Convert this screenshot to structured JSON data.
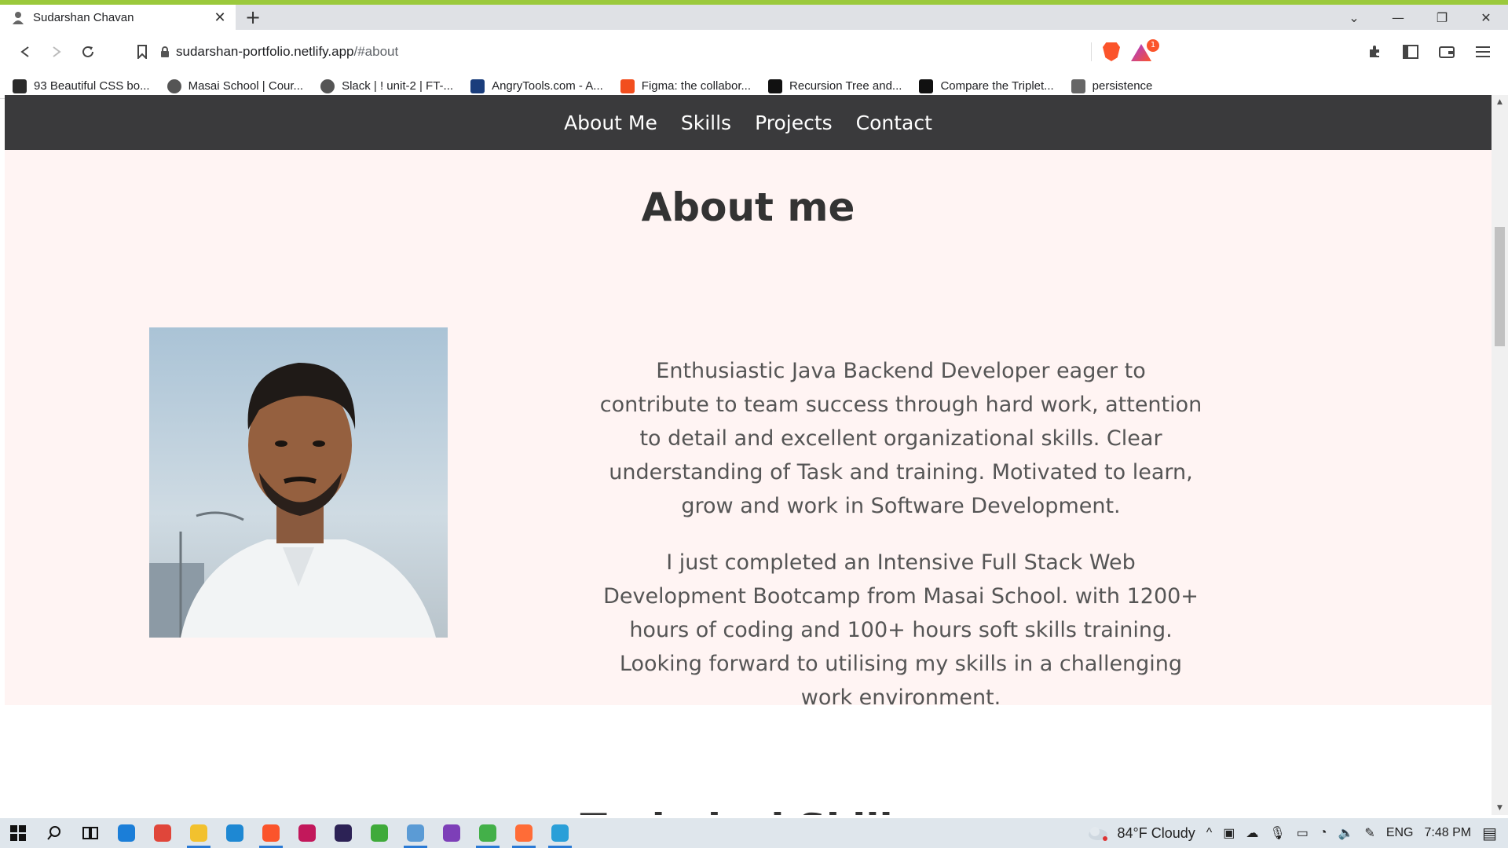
{
  "browser": {
    "tab_title": "Sudarshan Chavan",
    "url_host": "sudarshan-portfolio.netlify.app",
    "url_path": "/#about",
    "rewards_badge": "1",
    "bookmarks": [
      {
        "label": "93 Beautiful CSS bo...",
        "icon": "css-bookmark-icon",
        "color": "#2b2b2b"
      },
      {
        "label": "Masai School | Cour...",
        "icon": "globe-icon",
        "color": "#555555"
      },
      {
        "label": "Slack | ! unit-2 | FT-...",
        "icon": "globe-icon",
        "color": "#555555"
      },
      {
        "label": "AngryTools.com - A...",
        "icon": "angrytools-icon",
        "color": "#1a3d7c"
      },
      {
        "label": "Figma: the collabor...",
        "icon": "figma-icon",
        "color": "#f24e1e"
      },
      {
        "label": "Recursion Tree and...",
        "icon": "recursion-icon",
        "color": "#111111"
      },
      {
        "label": "Compare the Triplet...",
        "icon": "hackerrank-icon",
        "color": "#111111"
      },
      {
        "label": "persistence",
        "icon": "persistence-icon",
        "color": "#666666"
      }
    ]
  },
  "page": {
    "nav": [
      "About Me",
      "Skills",
      "Projects",
      "Contact"
    ],
    "about_title": "About me",
    "paragraphs": [
      "Enthusiastic Java Backend Developer eager to contribute to team success through hard work, attention to detail and excellent organizational skills. Clear understanding of Task and training. Motivated to learn, grow and work in Software Development.",
      "I just completed an Intensive Full Stack Web Development Bootcamp from Masai School. with 1200+ hours of coding and 100+ hours soft skills training. Looking forward to utilising my skills in a challenging work environment."
    ],
    "next_section_title": "Technical Skills"
  },
  "taskbar": {
    "weather": "84°F  Cloudy",
    "language": "ENG",
    "time": "7:48 PM",
    "apps": [
      {
        "name": "edge-icon",
        "color": "#1b7ed8",
        "active": false
      },
      {
        "name": "chrome-icon",
        "color": "#e0463a",
        "active": false
      },
      {
        "name": "file-explorer-icon",
        "color": "#f2c12e",
        "active": true
      },
      {
        "name": "vscode-icon",
        "color": "#1e88d3",
        "active": false
      },
      {
        "name": "brave-icon",
        "color": "#fb542b",
        "active": true
      },
      {
        "name": "intellij-icon",
        "color": "#c2185b",
        "active": false
      },
      {
        "name": "eclipse-icon",
        "color": "#2c2255",
        "active": false
      },
      {
        "name": "app-green-icon",
        "color": "#3faa3a",
        "active": false
      },
      {
        "name": "app-blue-icon",
        "color": "#5b9bd5",
        "active": true
      },
      {
        "name": "app-purple-icon",
        "color": "#7d3fb8",
        "active": false
      },
      {
        "name": "app-green2-icon",
        "color": "#43b049",
        "active": true
      },
      {
        "name": "postman-icon",
        "color": "#ff6c37",
        "active": true
      },
      {
        "name": "app-store-icon",
        "color": "#2a9fd8",
        "active": true
      }
    ]
  }
}
